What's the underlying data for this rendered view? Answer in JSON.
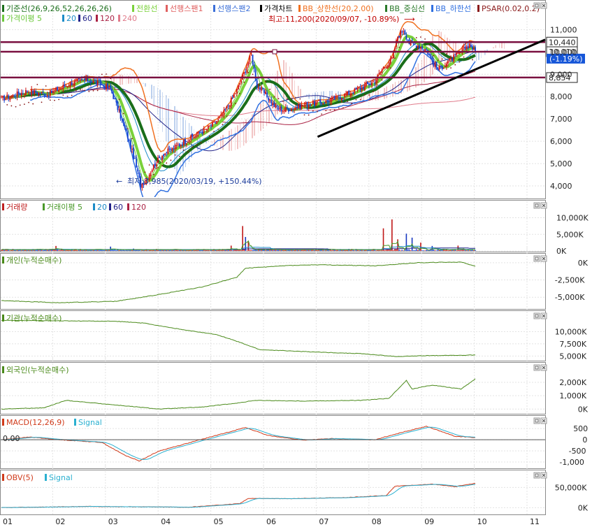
{
  "chart_data": [
    {
      "type": "candlestick",
      "panel": "price",
      "legend_line1": [
        {
          "label": "기준선(26,9,26,52,26,26,26)",
          "color": "#1a6e1a"
        },
        {
          "label": "전환선",
          "color": "#7ad13a"
        },
        {
          "label": "선행스팬1",
          "color": "#e06060"
        },
        {
          "label": "선행스팬2",
          "color": "#3b6fd8"
        },
        {
          "label": "가격차트",
          "color": "#000000"
        },
        {
          "label": "BB_상한선(20,2.00)",
          "color": "#f07020"
        },
        {
          "label": "BB_중심선",
          "color": "#2a7a2a"
        },
        {
          "label": "BB_하한선",
          "color": "#3070e0"
        },
        {
          "label": "PSAR(0.02,0.2)",
          "color": "#8a1a1a"
        }
      ],
      "legend_line2": [
        {
          "label": "가격이평 5",
          "color": "#6cc83c"
        },
        {
          "label": "20",
          "color": "#1c8cc8"
        },
        {
          "label": "60",
          "color": "#222288"
        },
        {
          "label": "120",
          "color": "#aa2244"
        },
        {
          "label": "240",
          "color": "#e07a8a"
        }
      ],
      "y_ticks": [
        "11,000",
        "10,000",
        "9,000",
        "8,000",
        "7,000",
        "6,000",
        "5,000",
        "4,000"
      ],
      "y_tick_values": [
        11000,
        10000,
        9000,
        8000,
        7000,
        6000,
        5000,
        4000
      ],
      "ylim": [
        3500,
        11700
      ],
      "price_labels": [
        {
          "text": "10,440",
          "value": 10440,
          "style": "box"
        },
        {
          "text": "10,010",
          "value": 10010,
          "style": "box"
        },
        {
          "text": "(-1.19%)",
          "value": 9700,
          "style": "current"
        },
        {
          "text": "8,854",
          "value": 8854,
          "style": "box"
        }
      ],
      "horizontal_lines": [
        10440,
        10010,
        8854
      ],
      "annotations": [
        {
          "text": "최고:11,200(2020/09/07, -10.89%)",
          "arrow": "⟶"
        },
        {
          "text": "최저:3,985(2020/03/19, +150.44%)",
          "arrow": "←"
        }
      ],
      "trendline": {
        "from": [
          "07",
          6200
        ],
        "to": [
          "11",
          10550
        ]
      },
      "close_keypoints": [
        [
          0,
          7900
        ],
        [
          18,
          8250
        ],
        [
          32,
          8100
        ],
        [
          48,
          8600
        ],
        [
          60,
          8750
        ],
        [
          68,
          8600
        ],
        [
          76,
          8350
        ],
        [
          82,
          7300
        ],
        [
          88,
          6200
        ],
        [
          93,
          5100
        ],
        [
          97,
          4050
        ],
        [
          101,
          4300
        ],
        [
          106,
          4900
        ],
        [
          112,
          5400
        ],
        [
          120,
          5700
        ],
        [
          128,
          6000
        ],
        [
          136,
          6300
        ],
        [
          144,
          6600
        ],
        [
          152,
          7000
        ],
        [
          158,
          7600
        ],
        [
          164,
          8300
        ],
        [
          170,
          9200
        ],
        [
          174,
          9900
        ],
        [
          178,
          8500
        ],
        [
          184,
          8100
        ],
        [
          190,
          7600
        ],
        [
          196,
          7400
        ],
        [
          204,
          7500
        ],
        [
          212,
          7650
        ],
        [
          220,
          7700
        ],
        [
          228,
          7800
        ],
        [
          236,
          8000
        ],
        [
          244,
          8200
        ],
        [
          252,
          8450
        ],
        [
          260,
          8700
        ],
        [
          266,
          9300
        ],
        [
          272,
          9700
        ],
        [
          276,
          10700
        ],
        [
          280,
          11000
        ],
        [
          284,
          10400
        ],
        [
          290,
          10300
        ],
        [
          296,
          10100
        ],
        [
          300,
          9600
        ],
        [
          304,
          9200
        ],
        [
          310,
          9500
        ],
        [
          316,
          9800
        ],
        [
          322,
          10100
        ],
        [
          326,
          10350
        ],
        [
          330,
          9990
        ]
      ],
      "volume_max": 12000,
      "volume_spikes": [
        [
          38,
          1500
        ],
        [
          76,
          1300
        ],
        [
          92,
          700
        ],
        [
          160,
          1600
        ],
        [
          168,
          7500
        ],
        [
          170,
          4200
        ],
        [
          172,
          2800
        ],
        [
          266,
          6800
        ],
        [
          272,
          9500
        ],
        [
          276,
          3500
        ],
        [
          282,
          5200
        ],
        [
          286,
          4000
        ],
        [
          292,
          2500
        ],
        [
          300,
          1500
        ],
        [
          318,
          1600
        ]
      ]
    },
    {
      "type": "bar",
      "panel": "volume",
      "legend": [
        {
          "label": "거래량",
          "color": "#c02020"
        },
        {
          "label": "거래이평 5",
          "color": "#4a9a2a"
        },
        {
          "label": "20",
          "color": "#1c8cc8"
        },
        {
          "label": "60",
          "color": "#222288"
        },
        {
          "label": "120",
          "color": "#aa2244"
        }
      ],
      "y_ticks": [
        "10,000K",
        "5,000K",
        "0K"
      ],
      "y_tick_values": [
        10000,
        5000,
        0
      ],
      "ylim": [
        0,
        12000
      ]
    },
    {
      "type": "line",
      "panel": "individual",
      "legend": [
        {
          "label": "개인(누적순매수)",
          "color": "#4a8a1a"
        }
      ],
      "y_ticks": [
        "0K",
        "-2,500K",
        "-5,000K"
      ],
      "y_tick_values": [
        0,
        -2500,
        -5000
      ],
      "ylim": [
        -6500,
        800
      ],
      "keypoints": [
        [
          0,
          -5500
        ],
        [
          40,
          -5800
        ],
        [
          80,
          -5600
        ],
        [
          110,
          -4600
        ],
        [
          140,
          -3500
        ],
        [
          164,
          -2100
        ],
        [
          170,
          -800
        ],
        [
          200,
          -400
        ],
        [
          220,
          -300
        ],
        [
          260,
          -450
        ],
        [
          290,
          0
        ],
        [
          320,
          100
        ],
        [
          330,
          -500
        ]
      ]
    },
    {
      "type": "line",
      "panel": "institution",
      "legend": [
        {
          "label": "기관(누적순매수)",
          "color": "#4a8a1a"
        }
      ],
      "y_ticks": [
        "10,000K",
        "7,500K",
        "5,000K"
      ],
      "y_tick_values": [
        10000,
        7500,
        5000
      ],
      "ylim": [
        4200,
        13200
      ],
      "keypoints": [
        [
          0,
          12300
        ],
        [
          80,
          12100
        ],
        [
          100,
          11700
        ],
        [
          130,
          10200
        ],
        [
          150,
          9400
        ],
        [
          165,
          7900
        ],
        [
          180,
          6300
        ],
        [
          220,
          5800
        ],
        [
          250,
          5500
        ],
        [
          275,
          4900
        ],
        [
          300,
          5100
        ],
        [
          330,
          5200
        ]
      ]
    },
    {
      "type": "line",
      "panel": "foreigner",
      "legend": [
        {
          "label": "외국인(누적순매수)",
          "color": "#4a8a1a"
        }
      ],
      "y_ticks": [
        "2,000K",
        "1,000K",
        "0K"
      ],
      "y_tick_values": [
        2000,
        1000,
        0
      ],
      "ylim": [
        -300,
        3100
      ],
      "keypoints": [
        [
          0,
          0
        ],
        [
          30,
          100
        ],
        [
          45,
          650
        ],
        [
          60,
          500
        ],
        [
          90,
          200
        ],
        [
          110,
          0
        ],
        [
          140,
          150
        ],
        [
          168,
          500
        ],
        [
          176,
          650
        ],
        [
          210,
          600
        ],
        [
          250,
          650
        ],
        [
          270,
          800
        ],
        [
          282,
          2150
        ],
        [
          286,
          1500
        ],
        [
          300,
          1800
        ],
        [
          320,
          1500
        ],
        [
          330,
          2250
        ]
      ]
    },
    {
      "type": "line",
      "panel": "macd",
      "legend": [
        {
          "label": "MACD(12,26,9)",
          "color": "#d03a1a"
        },
        {
          "label": "Signal",
          "color": "#2ab0d0"
        }
      ],
      "left_label": "0.00",
      "y_ticks": [
        "500",
        "0",
        "-500",
        "-1,000"
      ],
      "y_tick_values": [
        500,
        0,
        -500,
        -1000
      ],
      "ylim": [
        -1250,
        850
      ],
      "keypoints": [
        [
          0,
          0
        ],
        [
          20,
          120
        ],
        [
          40,
          0
        ],
        [
          70,
          -120
        ],
        [
          86,
          -700
        ],
        [
          96,
          -950
        ],
        [
          110,
          -500
        ],
        [
          130,
          -150
        ],
        [
          150,
          200
        ],
        [
          170,
          550
        ],
        [
          185,
          200
        ],
        [
          210,
          -20
        ],
        [
          230,
          50
        ],
        [
          260,
          0
        ],
        [
          280,
          350
        ],
        [
          296,
          600
        ],
        [
          316,
          150
        ],
        [
          330,
          100
        ]
      ]
    },
    {
      "type": "line",
      "panel": "obv",
      "legend": [
        {
          "label": "OBV(5)",
          "color": "#d03a1a"
        },
        {
          "label": "Signal",
          "color": "#2ab0d0"
        }
      ],
      "y_ticks": [
        "50,000K",
        "0K"
      ],
      "y_tick_values": [
        50000,
        0
      ],
      "ylim": [
        -15000,
        80000
      ],
      "keypoints": [
        [
          0,
          0
        ],
        [
          60,
          3000
        ],
        [
          100,
          2000
        ],
        [
          130,
          1000
        ],
        [
          166,
          10000
        ],
        [
          172,
          23000
        ],
        [
          200,
          22000
        ],
        [
          240,
          25000
        ],
        [
          268,
          30000
        ],
        [
          274,
          53000
        ],
        [
          300,
          58000
        ],
        [
          316,
          52000
        ],
        [
          330,
          60000
        ]
      ]
    }
  ],
  "x_axis": {
    "months": [
      "01",
      "02",
      "03",
      "04",
      "05",
      "06",
      "07",
      "08",
      "09",
      "10",
      "11"
    ]
  },
  "window_buttons": [
    "▭",
    "✕"
  ]
}
